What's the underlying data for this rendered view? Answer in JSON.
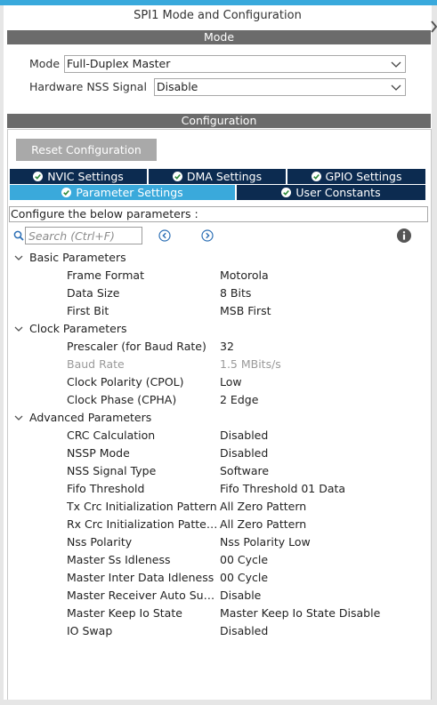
{
  "header": {
    "title": "SPI1 Mode and Configuration"
  },
  "mode_section": {
    "title": "Mode",
    "mode_label": "Mode",
    "mode_value": "Full-Duplex Master",
    "nss_label": "Hardware NSS Signal",
    "nss_value": "Disable"
  },
  "config_section": {
    "title": "Configuration",
    "reset_button": "Reset Configuration",
    "tabs": {
      "nvic": "NVIC Settings",
      "dma": "DMA Settings",
      "gpio": "GPIO Settings",
      "parameter": "Parameter Settings",
      "user_constants": "User Constants"
    },
    "active_tab": "Parameter Settings",
    "hint": "Configure the below parameters :",
    "search_placeholder": "Search (Ctrl+F)"
  },
  "groups": [
    {
      "title": "Basic Parameters",
      "params": [
        {
          "name": "Frame Format",
          "value": "Motorola"
        },
        {
          "name": "Data Size",
          "value": "8 Bits"
        },
        {
          "name": "First Bit",
          "value": "MSB First"
        }
      ]
    },
    {
      "title": "Clock Parameters",
      "params": [
        {
          "name": "Prescaler (for Baud Rate)",
          "value": "32"
        },
        {
          "name": "Baud Rate",
          "value": "1.5 MBits/s",
          "disabled": true
        },
        {
          "name": "Clock Polarity (CPOL)",
          "value": "Low"
        },
        {
          "name": "Clock Phase (CPHA)",
          "value": "2 Edge"
        }
      ]
    },
    {
      "title": "Advanced Parameters",
      "params": [
        {
          "name": "CRC Calculation",
          "value": "Disabled"
        },
        {
          "name": "NSSP Mode",
          "value": "Disabled"
        },
        {
          "name": "NSS Signal Type",
          "value": "Software"
        },
        {
          "name": "Fifo Threshold",
          "value": "Fifo Threshold 01 Data"
        },
        {
          "name": "Tx Crc Initialization Pattern",
          "value": "All Zero Pattern"
        },
        {
          "name": "Rx Crc Initialization Patte…",
          "value": "All Zero Pattern"
        },
        {
          "name": "Nss Polarity",
          "value": "Nss Polarity Low"
        },
        {
          "name": "Master Ss Idleness",
          "value": "00 Cycle"
        },
        {
          "name": "Master Inter Data Idleness",
          "value": "00 Cycle"
        },
        {
          "name": "Master Receiver Auto Su…",
          "value": "Disable"
        },
        {
          "name": "Master Keep Io State",
          "value": "Master Keep Io State Disable"
        },
        {
          "name": "IO Swap",
          "value": "Disabled"
        }
      ]
    }
  ],
  "colors": {
    "accent": "#39a9dc",
    "tab_dark": "#0c2b50",
    "tab_active": "#3aa9db",
    "section_bar": "#6b6b6b",
    "button": "#a9a9a9",
    "disabled_text": "#9a9a9a",
    "check_green": "#2e8b3a"
  },
  "icons": {
    "tab_tick": "check-circle-icon",
    "search_prev": "arrow-left-circle-icon",
    "search_next": "arrow-right-circle-icon",
    "info": "info-icon",
    "group_toggle": "chevron-down-icon",
    "dropdown": "chevron-down-icon",
    "collapse": "collapse-arrow-icon"
  }
}
